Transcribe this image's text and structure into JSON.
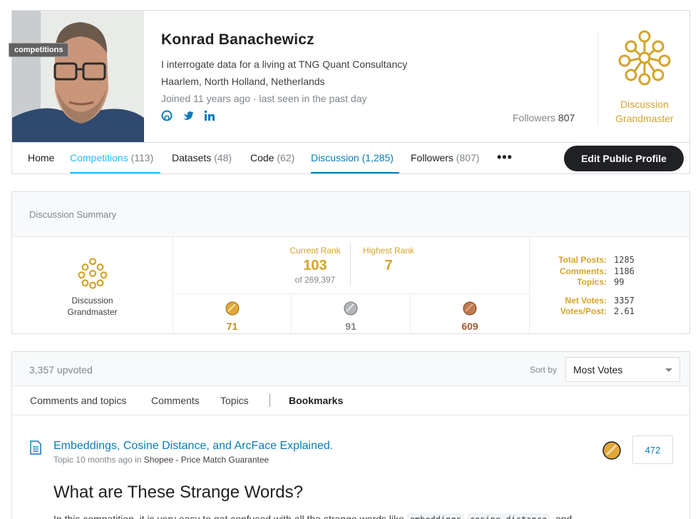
{
  "tooltip": "competitions",
  "profile": {
    "name": "Konrad Banachewicz",
    "bio": "I interrogate data for a living at TNG Quant Consultancy",
    "location": "Haarlem, North Holland, Netherlands",
    "joined": "Joined 11 years ago · last seen in the past day",
    "socials": [
      "github-icon",
      "twitter-icon",
      "linkedin-icon"
    ],
    "followers_label": "Followers",
    "followers_count": "807",
    "tier": "Discussion Grandmaster"
  },
  "tabs": [
    {
      "label": "Home",
      "count": ""
    },
    {
      "label": "Competitions",
      "count": "(113)"
    },
    {
      "label": "Datasets",
      "count": "(48)"
    },
    {
      "label": "Code",
      "count": "(62)"
    },
    {
      "label": "Discussion",
      "count": "(1,285)"
    },
    {
      "label": "Followers",
      "count": "(807)"
    }
  ],
  "more_label": "•••",
  "edit_button": "Edit Public Profile",
  "summary": {
    "title": "Discussion Summary",
    "tier_line1": "Discussion",
    "tier_line2": "Grandmaster",
    "current_rank_label": "Current Rank",
    "current_rank": "103",
    "current_rank_of": "of 269,397",
    "highest_rank_label": "Highest Rank",
    "highest_rank": "7",
    "medals": {
      "gold": "71",
      "silver": "91",
      "bronze": "609"
    },
    "stats": [
      {
        "label": "Total Posts:",
        "value": "1285"
      },
      {
        "label": "Comments:",
        "value": "1186"
      },
      {
        "label": "Topics:",
        "value": "99"
      },
      {
        "label": "Net Votes:",
        "value": "3357"
      },
      {
        "label": "Votes/Post:",
        "value": "2.61"
      }
    ]
  },
  "posts": {
    "upvoted": "3,357 upvoted",
    "sort_label": "Sort by",
    "sort_value": "Most Votes",
    "filters": [
      "Comments and topics",
      "Comments",
      "Topics",
      "Bookmarks"
    ],
    "item": {
      "title": "Embeddings, Cosine Distance, and ArcFace Explained.",
      "meta_prefix": "Topic 10 months ago in",
      "competition": "Shopee - Price Match Guarantee",
      "votes": "472",
      "heading": "What are These Strange Words?",
      "body_text": "In this competition, it is very easy to get confused with all the strange words like",
      "code1": "embeddings",
      "code2": "cosine distance",
      "body_tail": ", and"
    }
  },
  "colors": {
    "gold": "#d4a32a",
    "link": "#0a7bb5",
    "active_tab": "#20beff",
    "dark_button": "#202124"
  }
}
